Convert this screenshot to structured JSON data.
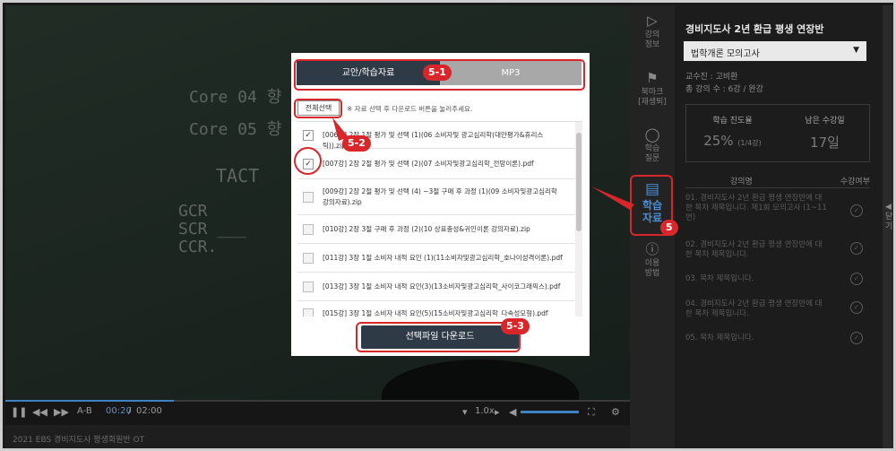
{
  "video": {
    "chalk_lines": [
      "Core 04  향",
      "Core 05  향",
      "TACT",
      "GCR\nSCR ___\nCCR."
    ],
    "caption": "2021 EBS 경비지도사 평생회원반 OT"
  },
  "controls": {
    "pause_icon": "pause-icon",
    "ab_label": "A-B",
    "time_current": "00:20",
    "time_separator": "/",
    "time_total": "02:00",
    "speed_label": "1.0x",
    "progress_fraction": 0.27,
    "volume_fraction": 1.0
  },
  "sidebar_icons": [
    {
      "name": "강의\n정보",
      "icon": "play-icon"
    },
    {
      "name": "북마크\n[재생퇴]",
      "icon": "bookmark-icon"
    },
    {
      "name": "학습\n질문",
      "icon": "chat-icon"
    },
    {
      "name": "학습\n자료",
      "icon": "document-icon"
    },
    {
      "name": "이용\n방법",
      "icon": "info-icon"
    }
  ],
  "panel": {
    "title": "경비지도사 2년 환급 평생 연장반",
    "select_value": "법학개론 모의고사",
    "teacher": "교수진 : 고비환",
    "lecture_count": "총 강의 수 : 6강 / 완강",
    "progress_label": "학습 진도율",
    "progress_value": "25%",
    "progress_sub": "(1/4강)",
    "remaining_label": "남은 수강일",
    "remaining_value": "17일",
    "col_lecture": "강의명",
    "col_status": "수강여부",
    "rows": [
      "01. 경비지도사 2년 환급 평생 연장반에 대한 목차 제목입니다. 제1회 모의고사 (1~11번)",
      "02. 경비지도사 2년 환급 평생 연장반에 대한 목차 제목입니다.",
      "03. 목차 제목입니다.",
      "04. 경비지도사 2년 환급 평생 연장반에 대한 목차 제목입니다.",
      "05. 목차 제목입니다."
    ],
    "collapse_label": "◀\n닫\n기"
  },
  "modal": {
    "tab_active": "교안/학습자료",
    "tab_inactive": "MP3",
    "select_all": "전체선택",
    "hint": "※ 자료 선택 후 다운로드 버튼을 눌러주세요.",
    "files": [
      {
        "name": "[006강] 2장 1절 평가 및 선택 (1)(06 소비자및 광고심리학(대안평가&휴리스틱)).zip",
        "checked": true
      },
      {
        "name": "[007강] 2장 2절 평가 및 선택 (2)(07 소비자및광고심리학_전망이론).pdf",
        "checked": true
      },
      {
        "name": "[009강] 2장 2절 평가 및 선택 (4) ~3절 구매 후 과정 (1)(09 소비자및광고심리학 강의자료).zip",
        "checked": false
      },
      {
        "name": "[010강] 2장 3절 구매 후 과정 (2)(10 상표충성&귀인이론 강의자료).zip",
        "checked": false
      },
      {
        "name": "[011강] 3장 1절 소비자 내적 요인 (1)(11소비자및광고심리학_호나이성격이론).pdf",
        "checked": false
      },
      {
        "name": "[013강] 3장 1절 소비자 내적 요인(3)(13소비자및광고심리학_사이코그래픽스).pdf",
        "checked": false
      },
      {
        "name": "[015강] 3장 1절 소비자 내적 요인(5)(15소비자및광고심리학_다속성모형).pdf",
        "checked": false
      }
    ],
    "download_button": "선택파일 다운로드"
  },
  "annotations": {
    "tabs": "5-1",
    "select": "5-2",
    "download": "5-3",
    "sidebar": "5"
  },
  "colors": {
    "accent": "#2f3a47",
    "annotation_red": "#d9262b",
    "active_blue": "#4a8fd6"
  }
}
